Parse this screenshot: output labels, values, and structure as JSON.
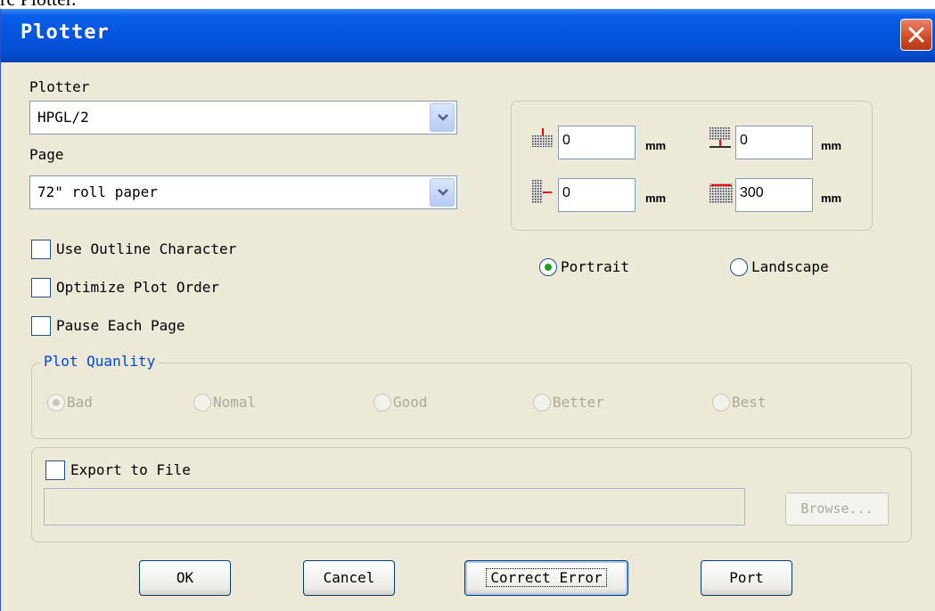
{
  "window": {
    "title": "Plotter",
    "above_text": "rc Plotter."
  },
  "plotter": {
    "label": "Plotter",
    "value": "HPGL/2"
  },
  "page": {
    "label": "Page",
    "value": "72\" roll paper"
  },
  "margins": {
    "top": {
      "value": "0",
      "unit": "mm"
    },
    "bottom": {
      "value": "0",
      "unit": "mm"
    },
    "left": {
      "value": "0",
      "unit": "mm"
    },
    "right": {
      "value": "300",
      "unit": "mm"
    }
  },
  "options": {
    "use_outline": {
      "label": "Use Outline Character",
      "checked": false
    },
    "optimize_order": {
      "label": "Optimize Plot Order",
      "checked": false
    },
    "pause_page": {
      "label": "Pause Each Page",
      "checked": false
    }
  },
  "orientation": {
    "portrait": "Portrait",
    "landscape": "Landscape",
    "selected": "Portrait"
  },
  "quality": {
    "legend": "Plot Quanlity",
    "options": [
      "Bad",
      "Nomal",
      "Good",
      "Better",
      "Best"
    ],
    "selected": "Bad"
  },
  "export": {
    "label": "Export to File",
    "checked": false,
    "path": "",
    "browse_label": "Browse..."
  },
  "buttons": {
    "ok": "OK",
    "cancel": "Cancel",
    "correct": "Correct Error",
    "port": "Port"
  },
  "colors": {
    "titlebar": "#0555df",
    "dialog_bg": "#ece9d8",
    "legend": "#0046d5",
    "radio_dot": "#21a121",
    "close": "#d04a23"
  }
}
